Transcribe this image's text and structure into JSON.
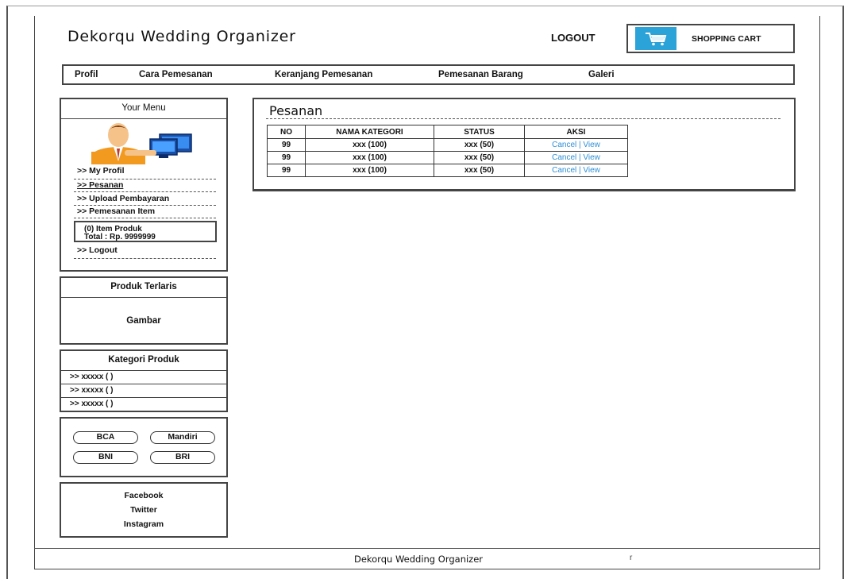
{
  "header": {
    "site_title": "Dekorqu Wedding Organizer",
    "logout_label": "LOGOUT",
    "cart_label": "SHOPPING CART",
    "cart_icon": "shopping-cart-icon",
    "accent_color": "#2ba3d8"
  },
  "nav": {
    "items": [
      {
        "label": "Profil"
      },
      {
        "label": "Cara Pemesanan"
      },
      {
        "label": "Keranjang Pemesanan"
      },
      {
        "label": "Pemesanan Barang"
      },
      {
        "label": "Galeri"
      }
    ]
  },
  "sidebar": {
    "menu": {
      "title": "Your Menu",
      "avatar_icon": "user-computer-icon",
      "links": [
        {
          "label": ">> My Profil"
        },
        {
          "label": ">> Pesanan"
        },
        {
          "label": ">> Upload Pembayaran"
        },
        {
          "label": ">> Pemesanan Item"
        },
        {
          "label": ">> Logout"
        }
      ],
      "cart_summary": {
        "items": "(0) Item Produk",
        "total": "Total : Rp. 9999999"
      }
    },
    "produk": {
      "title": "Produk Terlaris",
      "body": "Gambar"
    },
    "kategori": {
      "title": "Kategori Produk",
      "rows": [
        ">> xxxxx ( )",
        ">> xxxxx ( )",
        ">> xxxxx ( )"
      ]
    },
    "banks": [
      "BCA",
      "Mandiri",
      "BNI",
      "BRI"
    ],
    "social": [
      "Facebook",
      "Twitter",
      "Instagram"
    ]
  },
  "main": {
    "title": "Pesanan",
    "table": {
      "headers": [
        "NO",
        "NAMA KATEGORI",
        "STATUS",
        "AKSI"
      ],
      "rows": [
        {
          "no": "99",
          "nama": "xxx (100)",
          "status": "xxx (50)",
          "aksi_cancel": "Cancel",
          "aksi_sep": " | ",
          "aksi_view": "View"
        },
        {
          "no": "99",
          "nama": "xxx (100)",
          "status": "xxx (50)",
          "aksi_cancel": "Cancel",
          "aksi_sep": " | ",
          "aksi_view": "View"
        },
        {
          "no": "99",
          "nama": "xxx (100)",
          "status": "xxx (50)",
          "aksi_cancel": "Cancel",
          "aksi_sep": " | ",
          "aksi_view": "View"
        }
      ]
    },
    "link_color": "#2e8fd6"
  },
  "footer": {
    "text": "Dekorqu Wedding Organizer",
    "glyph": "r"
  }
}
